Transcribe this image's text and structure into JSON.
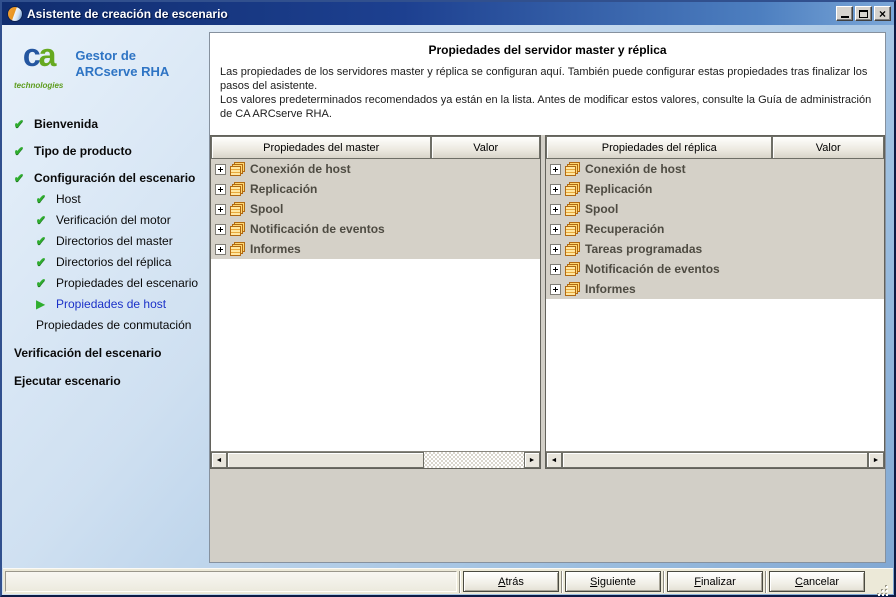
{
  "window": {
    "title": "Asistente de creación de escenario"
  },
  "icons": {
    "check": "✔",
    "current_arrow": "▶",
    "scroll_left": "◄",
    "scroll_right": "►",
    "close": "×"
  },
  "sidebar": {
    "logo": {
      "brand_c": "c",
      "brand_a": "a",
      "sub": "technologies",
      "product_line1": "Gestor de",
      "product_line2": "ARCserve RHA"
    },
    "steps": [
      {
        "label": "Bienvenida",
        "state": "done",
        "level": 0
      },
      {
        "label": "Tipo de producto",
        "state": "done",
        "level": 0
      },
      {
        "label": "Configuración del escenario",
        "state": "done",
        "level": 0
      },
      {
        "label": "Host",
        "state": "done",
        "level": 1
      },
      {
        "label": "Verificación del motor",
        "state": "done",
        "level": 1
      },
      {
        "label": "Directorios del master",
        "state": "done",
        "level": 1
      },
      {
        "label": "Directorios del réplica",
        "state": "done",
        "level": 1
      },
      {
        "label": "Propiedades del escenario",
        "state": "done",
        "level": 1
      },
      {
        "label": "Propiedades de host",
        "state": "current",
        "level": 1
      },
      {
        "label": "Propiedades de conmutación",
        "state": "pending",
        "level": 1
      },
      {
        "label": "Verificación del escenario",
        "state": "pending",
        "level": 0
      },
      {
        "label": "Ejecutar escenario",
        "state": "pending",
        "level": 0
      }
    ]
  },
  "content": {
    "title": "Propiedades del servidor master y réplica",
    "description": [
      "Las propiedades de los servidores master y réplica se configuran aquí. También puede configurar estas propiedades tras finalizar los pasos del asistente.",
      "Los valores predeterminados recomendados ya están en la lista. Antes de modificar estos valores, consulte la Guía de administración de CA ARCserve RHA."
    ]
  },
  "panels": {
    "master": {
      "name_header": "Propiedades del master",
      "value_header": "Valor",
      "items": [
        "Conexión de host",
        "Replicación",
        "Spool",
        "Notificación de eventos",
        "Informes"
      ]
    },
    "replica": {
      "name_header": "Propiedades del réplica",
      "value_header": "Valor",
      "items": [
        "Conexión de host",
        "Replicación",
        "Spool",
        "Recuperación",
        "Tareas programadas",
        "Notificación de eventos",
        "Informes"
      ]
    }
  },
  "footer": {
    "buttons": [
      {
        "accel": "A",
        "rest": "trás"
      },
      {
        "accel": "S",
        "rest": "iguiente"
      },
      {
        "accel": "F",
        "rest": "inalizar"
      },
      {
        "accel": "C",
        "rest": "ancelar"
      }
    ]
  },
  "colors": {
    "titlebar_start": "#102d6f",
    "titlebar_end": "#7ba7d8",
    "accent_green": "#2fae2f",
    "current_step_blue": "#1b31c8",
    "row_gray": "#d5d1c8"
  }
}
